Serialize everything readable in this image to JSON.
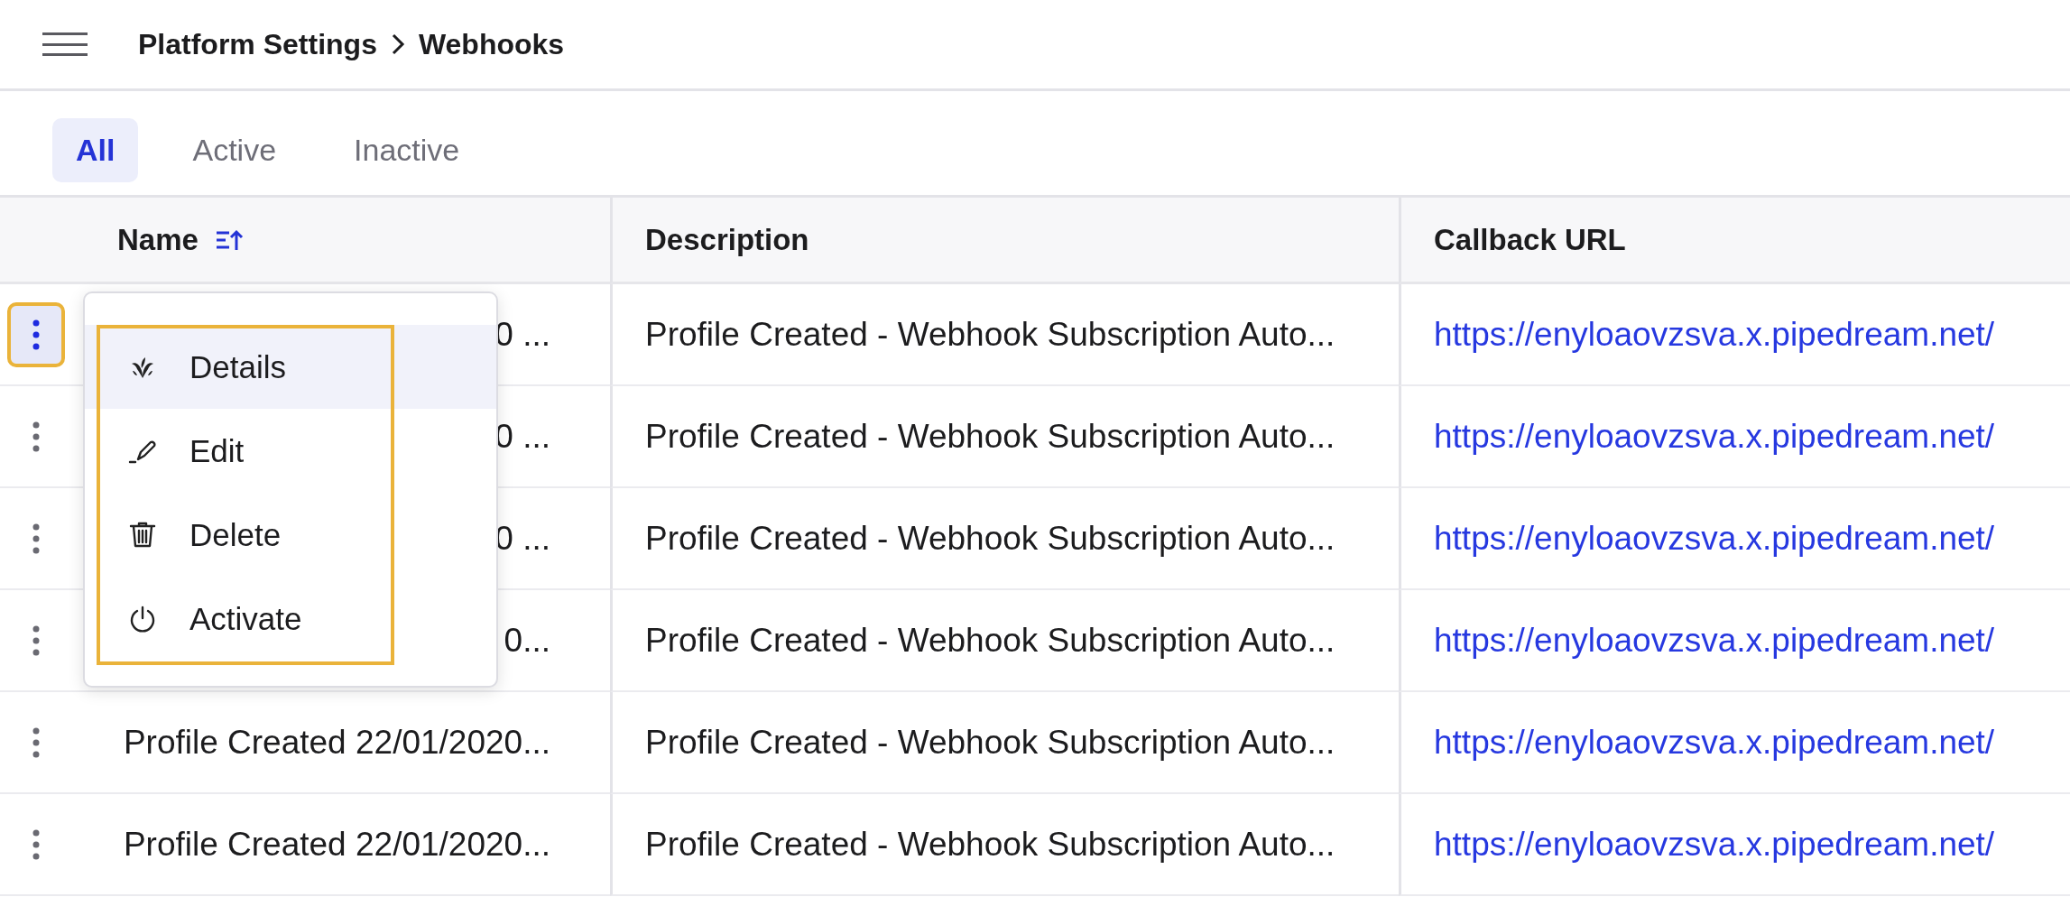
{
  "header": {
    "breadcrumb": [
      {
        "label": "Platform Settings"
      },
      {
        "label": "Webhooks"
      }
    ]
  },
  "tabs": [
    {
      "label": "All",
      "selected": true
    },
    {
      "label": "Active",
      "selected": false
    },
    {
      "label": "Inactive",
      "selected": false
    }
  ],
  "table": {
    "columns": [
      {
        "label": "Name",
        "sorted_ascending": true
      },
      {
        "label": "Description"
      },
      {
        "label": "Callback URL"
      }
    ],
    "rows": [
      {
        "name": "0 ...",
        "description": "Profile Created - Webhook Subscription Auto...",
        "callback_url": "https://enyloaovzsva.x.pipedream.net/",
        "menu_open": true
      },
      {
        "name": "0 ...",
        "description": "Profile Created - Webhook Subscription Auto...",
        "callback_url": "https://enyloaovzsva.x.pipedream.net/",
        "menu_open": false
      },
      {
        "name": "0 ...",
        "description": "Profile Created - Webhook Subscription Auto...",
        "callback_url": "https://enyloaovzsva.x.pipedream.net/",
        "menu_open": false
      },
      {
        "name": "0...",
        "description": "Profile Created - Webhook Subscription Auto...",
        "callback_url": "https://enyloaovzsva.x.pipedream.net/",
        "menu_open": false
      },
      {
        "name": "Profile Created 22/01/2020...",
        "description": "Profile Created - Webhook Subscription Auto...",
        "callback_url": "https://enyloaovzsva.x.pipedream.net/",
        "menu_open": false
      },
      {
        "name": "Profile Created 22/01/2020...",
        "description": "Profile Created - Webhook Subscription Auto...",
        "callback_url": "https://enyloaovzsva.x.pipedream.net/",
        "menu_open": false
      }
    ]
  },
  "row_menu": {
    "items": [
      {
        "kind": "details",
        "label": "Details",
        "selected": true
      },
      {
        "kind": "edit",
        "label": "Edit",
        "selected": false
      },
      {
        "kind": "delete",
        "label": "Delete",
        "selected": false
      },
      {
        "kind": "activate",
        "label": "Activate",
        "selected": false
      }
    ]
  }
}
